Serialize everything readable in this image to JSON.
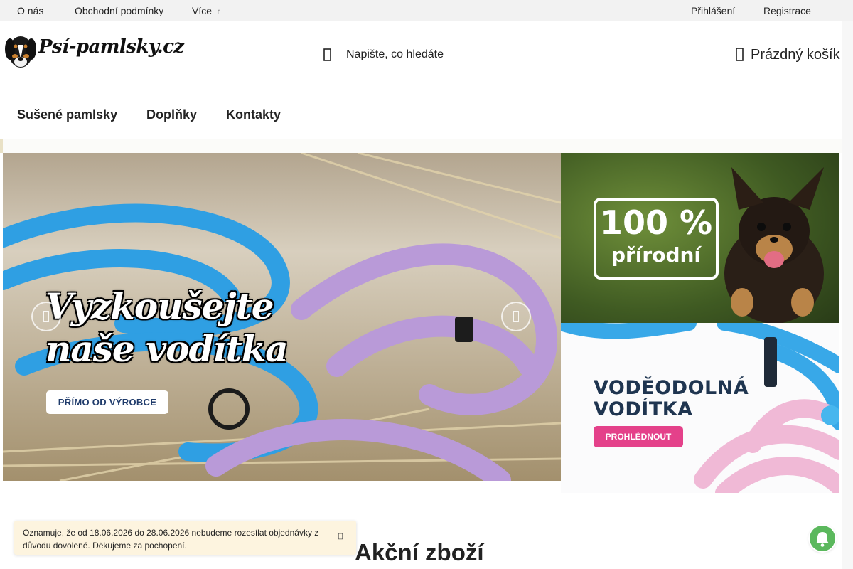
{
  "topbar": {
    "links": [
      "O nás",
      "Obchodní podmínky",
      "Více"
    ],
    "login": "Přihlášení",
    "register": "Registrace"
  },
  "header": {
    "logo_text": "Psí-pamlsky.cz",
    "search_placeholder": "Napište, co hledáte",
    "cart_label": "Prázdný košík"
  },
  "mainnav": {
    "items": [
      "Sušené pamlsky",
      "Doplňky",
      "Kontakty"
    ]
  },
  "carousel": {
    "headline_line1": "Vyzkoušejte",
    "headline_line2": "naše vodítka",
    "button": "PŘÍMO OD VÝROBCE"
  },
  "banner_natural": {
    "line1": "100 %",
    "line2": "přírodní"
  },
  "banner_leashes": {
    "line1": "VODĚODOLNÁ",
    "line2": "VODÍTKA",
    "button": "PROHLÉDNOUT"
  },
  "section_title": "Akční zboží",
  "notice": {
    "text": "Oznamuje, že od 18.06.2026 do 28.06.2026 nebudeme rozesílat objednávky z důvodu dovolené. Děkujeme za pochopení."
  },
  "colors": {
    "topbar_bg": "#f2f2f2",
    "notice_bg": "#fdf4df",
    "accent_pink": "#e4418a",
    "bell_green": "#5bb85d",
    "leash_blue": "#2f9fe3",
    "leash_purple": "#b99ad8"
  },
  "icons": {
    "search": "search-icon",
    "cart": "cart-icon",
    "dropdown": "chevron-down-icon",
    "notice_close": "close-icon",
    "bell": "bell-icon"
  }
}
